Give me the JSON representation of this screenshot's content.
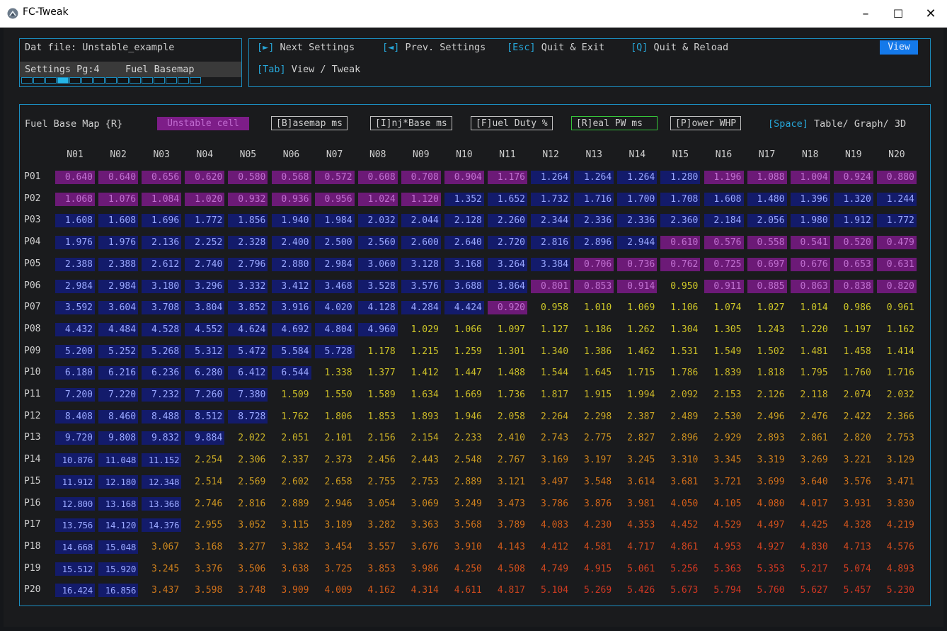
{
  "window": {
    "title": "FC-Tweak",
    "minimize": "–",
    "maximize": "☐",
    "close": "✕"
  },
  "info": {
    "dat_file": "Dat file: Unstable_example",
    "settings_pg": "Settings Pg:4",
    "settings_name": "Fuel Basemap",
    "progress_total": 15,
    "progress_active": 4
  },
  "shortcuts": {
    "next_key": "[►]",
    "next_label": " Next Settings",
    "prev_key": "[◄]",
    "prev_label": " Prev. Settings",
    "esc_key": "[Esc]",
    "esc_label": " Quit & Exit",
    "q_key": "[Q]",
    "q_label": " Quit & Reload",
    "tab_key": "[Tab]",
    "tab_label": " View / Tweak",
    "view_button": "View"
  },
  "toolbar": {
    "map_title": "Fuel Base Map {R}",
    "unstable_legend": "Unstable cell",
    "basemap_btn": "[B]asemap ms",
    "injbase_btn": "[I]nj*Base ms",
    "fuelduty_btn": "[F]uel Duty %",
    "realpw_btn": "[R]eal PW ms",
    "power_btn": "[P]ower WHP",
    "space_key": "[Space]",
    "space_label": " Table/ Graph/ 3D"
  },
  "colors": {
    "accent": "#1b8dbf",
    "key": "#27a6d8",
    "unstable": "#6c1a77",
    "stable_dark": "#131b6b",
    "view_button": "#1479ea"
  },
  "table": {
    "columns": [
      "N01",
      "N02",
      "N03",
      "N04",
      "N05",
      "N06",
      "N07",
      "N08",
      "N09",
      "N10",
      "N11",
      "N12",
      "N13",
      "N14",
      "N15",
      "N16",
      "N17",
      "N18",
      "N19",
      "N20"
    ],
    "rows": [
      "P01",
      "P02",
      "P03",
      "P04",
      "P05",
      "P06",
      "P07",
      "P08",
      "P09",
      "P10",
      "P11",
      "P12",
      "P13",
      "P14",
      "P15",
      "P16",
      "P17",
      "P18",
      "P19",
      "P20"
    ],
    "values": [
      [
        "0.640",
        "0.640",
        "0.656",
        "0.620",
        "0.580",
        "0.568",
        "0.572",
        "0.608",
        "0.708",
        "0.904",
        "1.176",
        "1.264",
        "1.264",
        "1.264",
        "1.280",
        "1.196",
        "1.088",
        "1.004",
        "0.924",
        "0.880"
      ],
      [
        "1.068",
        "1.076",
        "1.084",
        "1.020",
        "0.932",
        "0.936",
        "0.956",
        "1.024",
        "1.120",
        "1.352",
        "1.652",
        "1.732",
        "1.716",
        "1.700",
        "1.708",
        "1.608",
        "1.480",
        "1.396",
        "1.320",
        "1.244"
      ],
      [
        "1.608",
        "1.608",
        "1.696",
        "1.772",
        "1.856",
        "1.940",
        "1.984",
        "2.032",
        "2.044",
        "2.128",
        "2.260",
        "2.344",
        "2.336",
        "2.336",
        "2.360",
        "2.184",
        "2.056",
        "1.980",
        "1.912",
        "1.772"
      ],
      [
        "1.976",
        "1.976",
        "2.136",
        "2.252",
        "2.328",
        "2.400",
        "2.500",
        "2.560",
        "2.600",
        "2.640",
        "2.720",
        "2.816",
        "2.896",
        "2.944",
        "0.610",
        "0.576",
        "0.558",
        "0.541",
        "0.520",
        "0.479"
      ],
      [
        "2.388",
        "2.388",
        "2.612",
        "2.740",
        "2.796",
        "2.880",
        "2.984",
        "3.060",
        "3.128",
        "3.168",
        "3.264",
        "3.384",
        "0.706",
        "0.736",
        "0.762",
        "0.725",
        "0.697",
        "0.676",
        "0.653",
        "0.631"
      ],
      [
        "2.984",
        "2.984",
        "3.180",
        "3.296",
        "3.332",
        "3.412",
        "3.468",
        "3.528",
        "3.576",
        "3.688",
        "3.864",
        "0.801",
        "0.853",
        "0.914",
        "0.950",
        "0.911",
        "0.885",
        "0.863",
        "0.838",
        "0.820"
      ],
      [
        "3.592",
        "3.604",
        "3.708",
        "3.804",
        "3.852",
        "3.916",
        "4.020",
        "4.128",
        "4.284",
        "4.424",
        "0.920",
        "0.958",
        "1.010",
        "1.069",
        "1.106",
        "1.074",
        "1.027",
        "1.014",
        "0.986",
        "0.961"
      ],
      [
        "4.432",
        "4.484",
        "4.528",
        "4.552",
        "4.624",
        "4.692",
        "4.804",
        "4.960",
        "1.029",
        "1.066",
        "1.097",
        "1.127",
        "1.186",
        "1.262",
        "1.304",
        "1.305",
        "1.243",
        "1.220",
        "1.197",
        "1.162"
      ],
      [
        "5.200",
        "5.252",
        "5.268",
        "5.312",
        "5.472",
        "5.584",
        "5.728",
        "1.178",
        "1.215",
        "1.259",
        "1.301",
        "1.340",
        "1.386",
        "1.462",
        "1.531",
        "1.549",
        "1.502",
        "1.481",
        "1.458",
        "1.414"
      ],
      [
        "6.180",
        "6.216",
        "6.236",
        "6.280",
        "6.412",
        "6.544",
        "1.338",
        "1.377",
        "1.412",
        "1.447",
        "1.488",
        "1.544",
        "1.645",
        "1.715",
        "1.786",
        "1.839",
        "1.818",
        "1.795",
        "1.760",
        "1.716"
      ],
      [
        "7.200",
        "7.220",
        "7.232",
        "7.260",
        "7.380",
        "1.509",
        "1.550",
        "1.589",
        "1.634",
        "1.669",
        "1.736",
        "1.817",
        "1.915",
        "1.994",
        "2.092",
        "2.153",
        "2.126",
        "2.118",
        "2.074",
        "2.032"
      ],
      [
        "8.408",
        "8.460",
        "8.488",
        "8.512",
        "8.728",
        "1.762",
        "1.806",
        "1.853",
        "1.893",
        "1.946",
        "2.058",
        "2.264",
        "2.298",
        "2.387",
        "2.489",
        "2.530",
        "2.496",
        "2.476",
        "2.422",
        "2.366"
      ],
      [
        "9.720",
        "9.808",
        "9.832",
        "9.884",
        "2.022",
        "2.051",
        "2.101",
        "2.156",
        "2.154",
        "2.233",
        "2.410",
        "2.743",
        "2.775",
        "2.827",
        "2.896",
        "2.929",
        "2.893",
        "2.861",
        "2.820",
        "2.753"
      ],
      [
        "10.876",
        "11.048",
        "11.152",
        "2.254",
        "2.306",
        "2.337",
        "2.373",
        "2.456",
        "2.443",
        "2.548",
        "2.767",
        "3.169",
        "3.197",
        "3.245",
        "3.310",
        "3.345",
        "3.319",
        "3.269",
        "3.221",
        "3.129"
      ],
      [
        "11.912",
        "12.180",
        "12.348",
        "2.514",
        "2.569",
        "2.602",
        "2.658",
        "2.755",
        "2.753",
        "2.889",
        "3.121",
        "3.497",
        "3.548",
        "3.614",
        "3.681",
        "3.721",
        "3.699",
        "3.640",
        "3.576",
        "3.471"
      ],
      [
        "12.800",
        "13.168",
        "13.368",
        "2.746",
        "2.816",
        "2.889",
        "2.946",
        "3.054",
        "3.069",
        "3.249",
        "3.473",
        "3.786",
        "3.876",
        "3.981",
        "4.050",
        "4.105",
        "4.080",
        "4.017",
        "3.931",
        "3.830"
      ],
      [
        "13.756",
        "14.120",
        "14.376",
        "2.955",
        "3.052",
        "3.115",
        "3.189",
        "3.282",
        "3.363",
        "3.568",
        "3.789",
        "4.083",
        "4.230",
        "4.353",
        "4.452",
        "4.529",
        "4.497",
        "4.425",
        "4.328",
        "4.219"
      ],
      [
        "14.668",
        "15.048",
        "3.067",
        "3.168",
        "3.277",
        "3.382",
        "3.454",
        "3.557",
        "3.676",
        "3.910",
        "4.143",
        "4.412",
        "4.581",
        "4.717",
        "4.861",
        "4.953",
        "4.927",
        "4.830",
        "4.713",
        "4.576"
      ],
      [
        "15.512",
        "15.920",
        "3.245",
        "3.376",
        "3.506",
        "3.638",
        "3.725",
        "3.853",
        "3.986",
        "4.250",
        "4.508",
        "4.749",
        "4.915",
        "5.061",
        "5.256",
        "5.363",
        "5.353",
        "5.217",
        "5.074",
        "4.893"
      ],
      [
        "16.424",
        "16.856",
        "3.437",
        "3.598",
        "3.748",
        "3.909",
        "4.009",
        "4.162",
        "4.314",
        "4.611",
        "4.817",
        "5.104",
        "5.269",
        "5.426",
        "5.673",
        "5.794",
        "5.760",
        "5.627",
        "5.457",
        "5.230"
      ]
    ],
    "highlight": [
      [
        "u",
        "u",
        "u",
        "u",
        "u",
        "u",
        "u",
        "u",
        "u",
        "u",
        "u",
        "b",
        "b",
        "b",
        "b",
        "u",
        "u",
        "u",
        "u",
        "u"
      ],
      [
        "u",
        "u",
        "u",
        "u",
        "u",
        "u",
        "u",
        "u",
        "u",
        "b",
        "b",
        "b",
        "b",
        "b",
        "b",
        "b",
        "b",
        "b",
        "b",
        "b"
      ],
      [
        "b",
        "b",
        "b",
        "b",
        "b",
        "b",
        "b",
        "b",
        "b",
        "b",
        "b",
        "b",
        "b",
        "b",
        "b",
        "b",
        "b",
        "b",
        "b",
        "b"
      ],
      [
        "b",
        "b",
        "b",
        "b",
        "b",
        "b",
        "b",
        "b",
        "b",
        "b",
        "b",
        "b",
        "b",
        "b",
        "u",
        "u",
        "u",
        "u",
        "u",
        "u"
      ],
      [
        "b",
        "b",
        "b",
        "b",
        "b",
        "b",
        "b",
        "b",
        "b",
        "b",
        "b",
        "b",
        "u",
        "u",
        "u",
        "u",
        "u",
        "u",
        "u",
        "u"
      ],
      [
        "b",
        "b",
        "b",
        "b",
        "b",
        "b",
        "b",
        "b",
        "b",
        "b",
        "b",
        "u",
        "u",
        "u",
        "-",
        "u",
        "u",
        "u",
        "u",
        "u"
      ],
      [
        "b",
        "b",
        "b",
        "b",
        "b",
        "b",
        "b",
        "b",
        "b",
        "b",
        "u",
        "-",
        "-",
        "-",
        "-",
        "-",
        "-",
        "-",
        "-",
        "-"
      ],
      [
        "b",
        "b",
        "b",
        "b",
        "b",
        "b",
        "b",
        "b",
        "-",
        "-",
        "-",
        "-",
        "-",
        "-",
        "-",
        "-",
        "-",
        "-",
        "-",
        "-"
      ],
      [
        "b",
        "b",
        "b",
        "b",
        "b",
        "b",
        "b",
        "-",
        "-",
        "-",
        "-",
        "-",
        "-",
        "-",
        "-",
        "-",
        "-",
        "-",
        "-",
        "-"
      ],
      [
        "b",
        "b",
        "b",
        "b",
        "b",
        "b",
        "-",
        "-",
        "-",
        "-",
        "-",
        "-",
        "-",
        "-",
        "-",
        "-",
        "-",
        "-",
        "-",
        "-"
      ],
      [
        "b",
        "b",
        "b",
        "b",
        "b",
        "-",
        "-",
        "-",
        "-",
        "-",
        "-",
        "-",
        "-",
        "-",
        "-",
        "-",
        "-",
        "-",
        "-",
        "-"
      ],
      [
        "b",
        "b",
        "b",
        "b",
        "b",
        "-",
        "-",
        "-",
        "-",
        "-",
        "-",
        "-",
        "-",
        "-",
        "-",
        "-",
        "-",
        "-",
        "-",
        "-"
      ],
      [
        "b",
        "b",
        "b",
        "b",
        "-",
        "-",
        "-",
        "-",
        "-",
        "-",
        "-",
        "-",
        "-",
        "-",
        "-",
        "-",
        "-",
        "-",
        "-",
        "-"
      ],
      [
        "b",
        "b",
        "b",
        "-",
        "-",
        "-",
        "-",
        "-",
        "-",
        "-",
        "-",
        "-",
        "-",
        "-",
        "-",
        "-",
        "-",
        "-",
        "-",
        "-"
      ],
      [
        "b",
        "b",
        "b",
        "-",
        "-",
        "-",
        "-",
        "-",
        "-",
        "-",
        "-",
        "-",
        "-",
        "-",
        "-",
        "-",
        "-",
        "-",
        "-",
        "-"
      ],
      [
        "b",
        "b",
        "b",
        "-",
        "-",
        "-",
        "-",
        "-",
        "-",
        "-",
        "-",
        "-",
        "-",
        "-",
        "-",
        "-",
        "-",
        "-",
        "-",
        "-"
      ],
      [
        "b",
        "b",
        "b",
        "-",
        "-",
        "-",
        "-",
        "-",
        "-",
        "-",
        "-",
        "-",
        "-",
        "-",
        "-",
        "-",
        "-",
        "-",
        "-",
        "-"
      ],
      [
        "b",
        "b",
        "-",
        "-",
        "-",
        "-",
        "-",
        "-",
        "-",
        "-",
        "-",
        "-",
        "-",
        "-",
        "-",
        "-",
        "-",
        "-",
        "-",
        "-"
      ],
      [
        "b",
        "b",
        "-",
        "-",
        "-",
        "-",
        "-",
        "-",
        "-",
        "-",
        "-",
        "-",
        "-",
        "-",
        "-",
        "-",
        "-",
        "-",
        "-",
        "-"
      ],
      [
        "b",
        "b",
        "-",
        "-",
        "-",
        "-",
        "-",
        "-",
        "-",
        "-",
        "-",
        "-",
        "-",
        "-",
        "-",
        "-",
        "-",
        "-",
        "-",
        "-"
      ]
    ]
  }
}
